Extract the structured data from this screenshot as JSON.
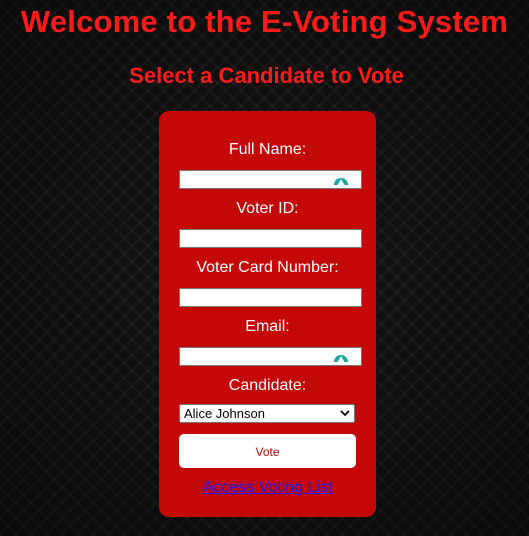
{
  "page": {
    "title": "Welcome to the E-Voting System",
    "subtitle": "Select a Candidate to Vote"
  },
  "form": {
    "full_name_label": "Full Name:",
    "full_name_value": "",
    "voter_id_label": "Voter ID:",
    "voter_id_value": "",
    "voter_card_label": "Voter Card Number:",
    "voter_card_value": "",
    "email_label": "Email:",
    "email_value": "",
    "candidate_label": "Candidate:",
    "candidate_selected": "Alice Johnson",
    "vote_button": "Vote",
    "voting_list_link": "Access Voting List"
  },
  "colors": {
    "heading": "#ff1a1a",
    "card": "#c40808",
    "link": "#1a1aff",
    "extension_icon": "#1aa3a3"
  },
  "icons": {
    "autofill": "password-manager-icon",
    "dropdown": "chevron-down-icon"
  }
}
